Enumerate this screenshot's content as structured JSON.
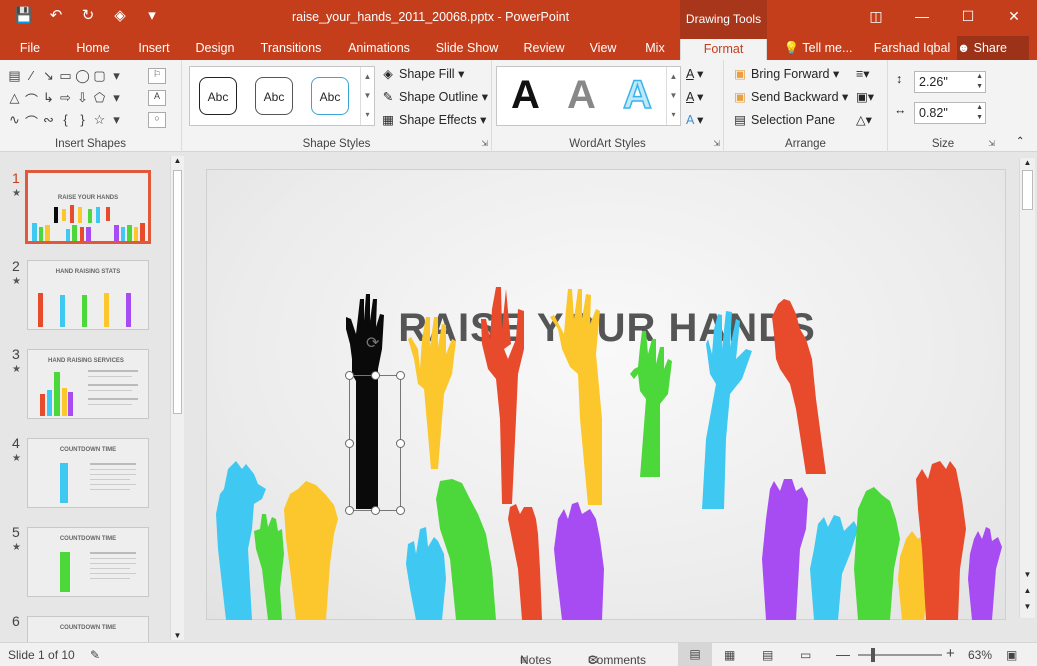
{
  "titlebar": {
    "document_title": "raise_your_hands_2011_20068.pptx - PowerPoint",
    "contextual_tools": "Drawing Tools",
    "qat_icons": [
      "save-icon",
      "undo-icon",
      "redo-icon",
      "slideshow-icon",
      "customize-icon"
    ]
  },
  "tabs": {
    "file": "File",
    "home": "Home",
    "insert": "Insert",
    "design": "Design",
    "transitions": "Transitions",
    "animations": "Animations",
    "slideshow": "Slide Show",
    "review": "Review",
    "view": "View",
    "mix": "Mix",
    "format": "Format",
    "tellme": "Tell me...",
    "user": "Farshad Iqbal",
    "share": "Share"
  },
  "ribbon": {
    "insert_shapes": {
      "label": "Insert Shapes"
    },
    "shape_styles": {
      "label": "Shape Styles",
      "abc1": "Abc",
      "abc2": "Abc",
      "abc3": "Abc",
      "fill": "Shape Fill",
      "outline": "Shape Outline",
      "effects": "Shape Effects"
    },
    "wordart": {
      "label": "WordArt Styles",
      "a1": "A",
      "a2": "A",
      "a3": "A"
    },
    "arrange": {
      "label": "Arrange",
      "bring_forward": "Bring Forward",
      "send_backward": "Send Backward",
      "selection_pane": "Selection Pane"
    },
    "size": {
      "label": "Size",
      "height": "2.26\"",
      "width": "0.82\""
    }
  },
  "slides": [
    {
      "num": "1",
      "title": "RAISE YOUR HANDS"
    },
    {
      "num": "2",
      "title": "HAND RAISING STATS"
    },
    {
      "num": "3",
      "title": "HAND RAISING SERVICES"
    },
    {
      "num": "4",
      "title": "COUNTDOWN TIME"
    },
    {
      "num": "5",
      "title": "COUNTDOWN TIME"
    },
    {
      "num": "6",
      "title": "COUNTDOWN TIME"
    }
  ],
  "slide": {
    "title": "RAISE YOUR HANDS"
  },
  "status": {
    "slide_info": "Slide 1 of 10",
    "notes": "Notes",
    "comments": "Comments",
    "zoom": "63%"
  },
  "colors": {
    "accent": "#c43e1c",
    "hand_blue": "#3ec8f2",
    "hand_green": "#4cd83a",
    "hand_yellow": "#fcc72c",
    "hand_red": "#e84a2c",
    "hand_purple": "#a64cf2",
    "hand_black": "#0a0a0a"
  }
}
